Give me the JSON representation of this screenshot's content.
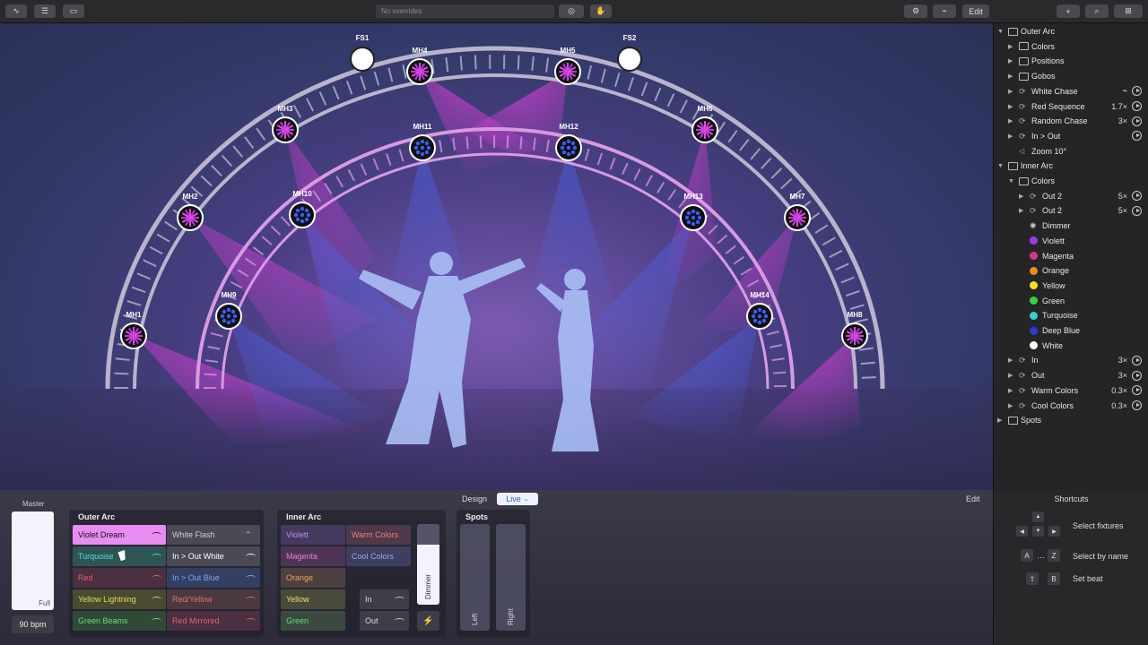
{
  "toolbar": {
    "overrides_placeholder": "No overrides",
    "edit_label": "Edit"
  },
  "stage": {
    "fixtures": [
      {
        "id": "FS1",
        "kind": "spot"
      },
      {
        "id": "FS2",
        "kind": "spot"
      },
      {
        "id": "MH1",
        "kind": "outer"
      },
      {
        "id": "MH2",
        "kind": "outer"
      },
      {
        "id": "MH3",
        "kind": "outer"
      },
      {
        "id": "MH4",
        "kind": "outer"
      },
      {
        "id": "MH5",
        "kind": "outer"
      },
      {
        "id": "MH6",
        "kind": "outer"
      },
      {
        "id": "MH7",
        "kind": "outer"
      },
      {
        "id": "MH8",
        "kind": "outer"
      },
      {
        "id": "MH9",
        "kind": "inner"
      },
      {
        "id": "MH10",
        "kind": "inner"
      },
      {
        "id": "MH11",
        "kind": "inner"
      },
      {
        "id": "MH12",
        "kind": "inner"
      },
      {
        "id": "MH13",
        "kind": "inner"
      },
      {
        "id": "MH14",
        "kind": "inner"
      }
    ]
  },
  "sidebar": {
    "rows": [
      {
        "label": "Outer Arc",
        "arrow": "▼",
        "icon": "folder",
        "count": "",
        "play": false
      },
      {
        "label": "Colors",
        "arrow": "▶",
        "icon": "folder",
        "count": "",
        "play": false
      },
      {
        "label": "Positions",
        "arrow": "▶",
        "icon": "folder",
        "count": "",
        "play": false
      },
      {
        "label": "Gobos",
        "arrow": "▶",
        "icon": "folder",
        "count": "",
        "play": false
      },
      {
        "label": "White Chase",
        "arrow": "▶",
        "icon": "cycle",
        "count": "⌁",
        "play": true
      },
      {
        "label": "Red Sequence",
        "arrow": "▶",
        "icon": "cycle",
        "count": "1.7×",
        "play": true
      },
      {
        "label": "Random Chase",
        "arrow": "▶",
        "icon": "cycle",
        "count": "3×",
        "play": true
      },
      {
        "label": "In > Out",
        "arrow": "▶",
        "icon": "cycle",
        "count": "",
        "play": true
      },
      {
        "label": "Zoom 10°",
        "arrow": "",
        "icon": "zoom",
        "count": "",
        "play": false
      },
      {
        "label": "Inner Arc",
        "arrow": "▼",
        "icon": "folder",
        "count": "",
        "play": false
      },
      {
        "label": "Colors",
        "arrow": "▼",
        "icon": "folder",
        "count": "",
        "play": false
      },
      {
        "label": "Out 2",
        "arrow": "▶",
        "icon": "cycle",
        "count": "5×",
        "play": true
      },
      {
        "label": "Out 2",
        "arrow": "▶",
        "icon": "cycle",
        "count": "5×",
        "play": true
      },
      {
        "label": "Dimmer",
        "arrow": "",
        "icon": "sun",
        "count": "",
        "play": false
      },
      {
        "label": "Violett",
        "arrow": "",
        "icon": "#9b3fe0",
        "count": "",
        "play": false
      },
      {
        "label": "Magenta",
        "arrow": "",
        "icon": "#e0338f",
        "count": "",
        "play": false
      },
      {
        "label": "Orange",
        "arrow": "",
        "icon": "#f08a24",
        "count": "",
        "play": false
      },
      {
        "label": "Yellow",
        "arrow": "",
        "icon": "#f2e422",
        "count": "",
        "play": false
      },
      {
        "label": "Green",
        "arrow": "",
        "icon": "#3bd13b",
        "count": "",
        "play": false
      },
      {
        "label": "Turquoise",
        "arrow": "",
        "icon": "#2fd6c8",
        "count": "",
        "play": false
      },
      {
        "label": "Deep Blue",
        "arrow": "",
        "icon": "#2a3bd8",
        "count": "",
        "play": false
      },
      {
        "label": "White",
        "arrow": "",
        "icon": "#ffffff",
        "count": "",
        "play": false
      },
      {
        "label": "In",
        "arrow": "▶",
        "icon": "cycle",
        "count": "3×",
        "play": true
      },
      {
        "label": "Out",
        "arrow": "▶",
        "icon": "cycle",
        "count": "3×",
        "play": true
      },
      {
        "label": "Warm Colors",
        "arrow": "▶",
        "icon": "cycle",
        "count": "0.3×",
        "play": true
      },
      {
        "label": "Cool Colors",
        "arrow": "▶",
        "icon": "cycle",
        "count": "0.3×",
        "play": true
      },
      {
        "label": "Spots",
        "arrow": "▶",
        "icon": "folder",
        "count": "",
        "play": false
      }
    ]
  },
  "mode": {
    "design_label": "Design",
    "live_label": "Live",
    "edit_label": "Edit"
  },
  "master": {
    "title": "Master",
    "level_label": "Full",
    "level": 1.0,
    "bpm": "90 bpm"
  },
  "outer_arc": {
    "title": "Outer Arc",
    "left": [
      {
        "label": "Violet Dream",
        "color": "#e98cf2",
        "text": "#111",
        "active": true
      },
      {
        "label": "Turquoise",
        "color": "#2f5454",
        "text": "#4fe0d0",
        "active": false
      },
      {
        "label": "Red",
        "color": "#4a3040",
        "text": "#e06070",
        "active": false
      },
      {
        "label": "Yellow Lightning",
        "color": "#4a4a30",
        "text": "#e0d860",
        "active": false
      },
      {
        "label": "Green Beams",
        "color": "#304a38",
        "text": "#60e070",
        "active": false
      }
    ],
    "right": [
      {
        "label": "White Flash",
        "color": "#4a4a55",
        "text": "#cfcfd8"
      },
      {
        "label": "In > Out White",
        "color": "#4a4a55",
        "text": "#ffffff"
      },
      {
        "label": "In > Out Blue",
        "color": "#344060",
        "text": "#7fa0ff"
      },
      {
        "label": "Red/Yellow",
        "color": "#4a3a40",
        "text": "#e07070"
      },
      {
        "label": "Red Mirrored",
        "color": "#4a3040",
        "text": "#e06070"
      }
    ]
  },
  "inner_arc": {
    "title": "Inner Arc",
    "left": [
      {
        "label": "Violett",
        "color": "#463a5e",
        "text": "#b78cf0"
      },
      {
        "label": "Magenta",
        "color": "#4e3556",
        "text": "#f07ad0"
      },
      {
        "label": "Orange",
        "color": "#4e4040",
        "text": "#f0a050"
      },
      {
        "label": "Yellow",
        "color": "#4a4a3a",
        "text": "#e8e060"
      },
      {
        "label": "Green",
        "color": "#3a4a40",
        "text": "#60e070"
      }
    ],
    "right": [
      {
        "label": "Warm Colors",
        "color": "#4e3a4a",
        "text": "#f07a8a"
      },
      {
        "label": "Cool Colors",
        "color": "#3e3e5e",
        "text": "#a0a8f0"
      }
    ],
    "in_label": "In",
    "out_label": "Out",
    "dimmer_label": "Dimmer",
    "dimmer_level": 0.75
  },
  "spots": {
    "title": "Spots",
    "left_label": "Left",
    "right_label": "Right"
  },
  "shortcuts": {
    "title": "Shortcuts",
    "select_fixtures": "Select fixtures",
    "select_by_name": "Select by name",
    "key_a": "A",
    "key_ellipsis": "…",
    "key_z": "Z",
    "set_beat": "Set beat",
    "key_shift": "⇧",
    "key_b": "B"
  }
}
